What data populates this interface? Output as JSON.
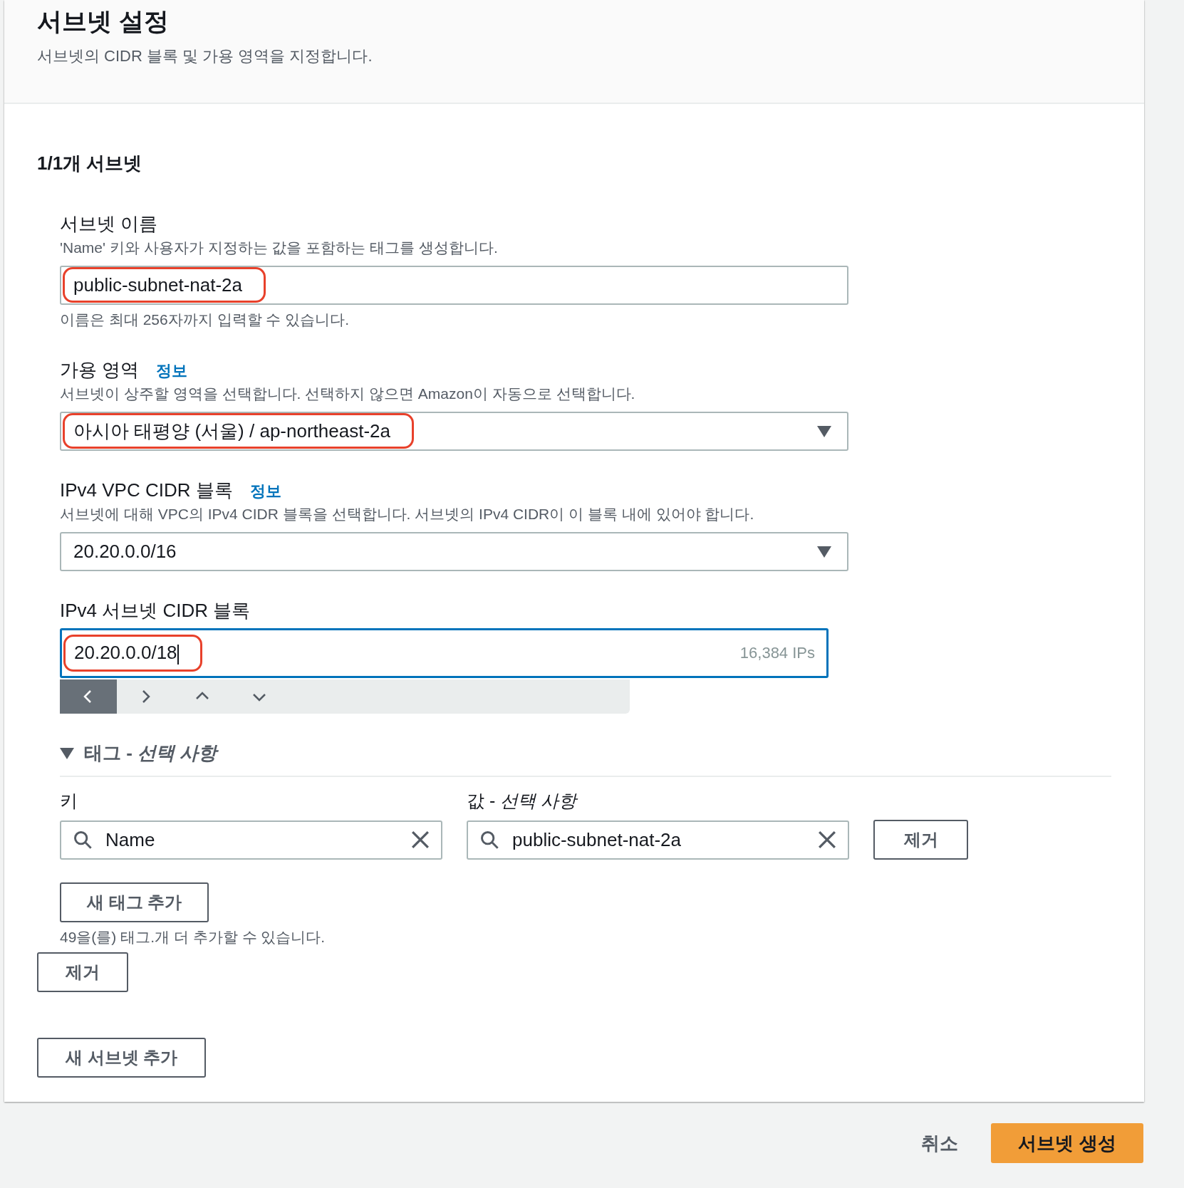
{
  "header": {
    "title": "서브넷 설정",
    "description": "서브넷의 CIDR 블록 및 가용 영역을 지정합니다."
  },
  "section_title": "1/1개 서브넷",
  "fields": [
    {
      "kind": "text",
      "label": "서브넷 이름",
      "description": "'Name' 키와 사용자가 지정하는 값을 포함하는 태그를 생성합니다.",
      "value": "public-subnet-nat-2a",
      "hint": "이름은 최대 256자까지 입력할 수 있습니다.",
      "highlighted": true
    },
    {
      "kind": "select",
      "label": "가용 영역",
      "info_link": "정보",
      "description": "서브넷이 상주할 영역을 선택합니다. 선택하지 않으면 Amazon이 자동으로 선택합니다.",
      "value": "아시아 태평양 (서울) / ap-northeast-2a",
      "highlighted": true
    },
    {
      "kind": "select",
      "label": "IPv4 VPC CIDR 블록",
      "info_link": "정보",
      "description": "서브넷에 대해 VPC의 IPv4 CIDR 블록을 선택합니다. 서브넷의 IPv4 CIDR이 이 블록 내에 있어야 합니다.",
      "value": "20.20.0.0/16",
      "highlighted": false
    },
    {
      "kind": "cidr",
      "label": "IPv4 서브넷 CIDR 블록",
      "value": "20.20.0.0/18",
      "ip_count": "16,384 IPs",
      "focused": true,
      "highlighted": true
    }
  ],
  "cidr_stepper": [
    {
      "selected": true
    },
    {
      "selected": false
    },
    {
      "selected": false
    },
    {
      "selected": false
    }
  ],
  "tags": {
    "expanded": true,
    "title": "태그 - *선택 사항*",
    "key_label": "키",
    "value_label": "값 - *선택 사항*",
    "rows": [
      {
        "key": "Name",
        "value": "public-subnet-nat-2a",
        "remove_button": "제거"
      }
    ],
    "add_button": "새 태그 추가",
    "limit_hint": "49을(를) 태그.개 더 추가할 수 있습니다."
  },
  "remove_subnet_button": "제거",
  "add_subnet_button": "새 서브넷 추가",
  "footer": {
    "cancel": "취소",
    "submit": "서브넷 생성"
  }
}
